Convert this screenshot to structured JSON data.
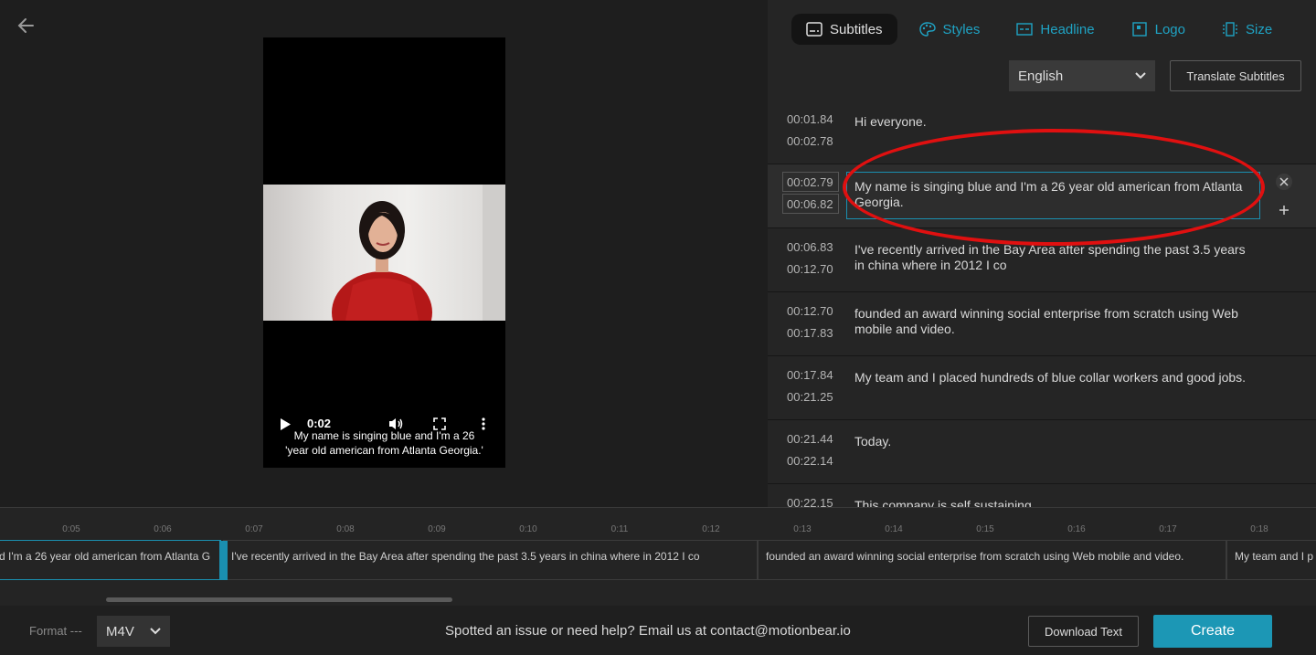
{
  "preview": {
    "back_icon": "arrow-left-icon",
    "video": {
      "time": "0:02",
      "caption_line1": "My name is singing blue and I'm a 26",
      "caption_line2": "'year old american from Atlanta Georgia.'",
      "icons": [
        "play-icon",
        "volume-icon",
        "fullscreen-icon",
        "more-vertical-icon"
      ]
    }
  },
  "tabs": [
    {
      "label": "Subtitles",
      "icon": "subtitles-icon",
      "active": true
    },
    {
      "label": "Styles",
      "icon": "palette-icon",
      "active": false
    },
    {
      "label": "Headline",
      "icon": "headline-icon",
      "active": false
    },
    {
      "label": "Logo",
      "icon": "logo-icon",
      "active": false
    },
    {
      "label": "Size",
      "icon": "size-icon",
      "active": false
    }
  ],
  "language": {
    "selected": "English"
  },
  "translate_label": "Translate Subtitles",
  "subtitles": [
    {
      "start": "00:01.84",
      "end": "00:02.78",
      "text": "Hi everyone."
    },
    {
      "start": "00:02.79",
      "end": "00:06.82",
      "text": "My name is singing blue and I'm a 26 year old american from Atlanta Georgia."
    },
    {
      "start": "00:06.83",
      "end": "00:12.70",
      "text": "I've recently arrived in the Bay Area after spending the past 3.5 years in china where in 2012 I co"
    },
    {
      "start": "00:12.70",
      "end": "00:17.83",
      "text": "founded an award winning social enterprise from scratch using Web mobile and video."
    },
    {
      "start": "00:17.84",
      "end": "00:21.25",
      "text": "My team and I placed hundreds of blue collar workers and good jobs."
    },
    {
      "start": "00:21.44",
      "end": "00:22.14",
      "text": "Today."
    },
    {
      "start": "00:22.15",
      "end": "",
      "text": "This company is self sustaining"
    }
  ],
  "timeline": {
    "ticks": [
      "0:05",
      "0:06",
      "0:07",
      "0:08",
      "0:09",
      "0:10",
      "0:11",
      "0:12",
      "0:13",
      "0:14",
      "0:15",
      "0:16",
      "0:17",
      "0:18"
    ],
    "clips": [
      "d I'm a 26 year old american from Atlanta G",
      "I've recently arrived in the Bay Area after spending the past 3.5 years in china where in 2012 I co",
      "founded an award winning social enterprise from scratch using Web mobile and video.",
      "My team and I p"
    ]
  },
  "footer": {
    "format_label": "Format ---",
    "format_value": "M4V",
    "help_text": "Spotted an issue or need help? Email us at contact@motionbear.io",
    "download_label": "Download Text",
    "create_label": "Create"
  },
  "colors": {
    "accent": "#1c97b5",
    "highlight": "#e01010"
  }
}
